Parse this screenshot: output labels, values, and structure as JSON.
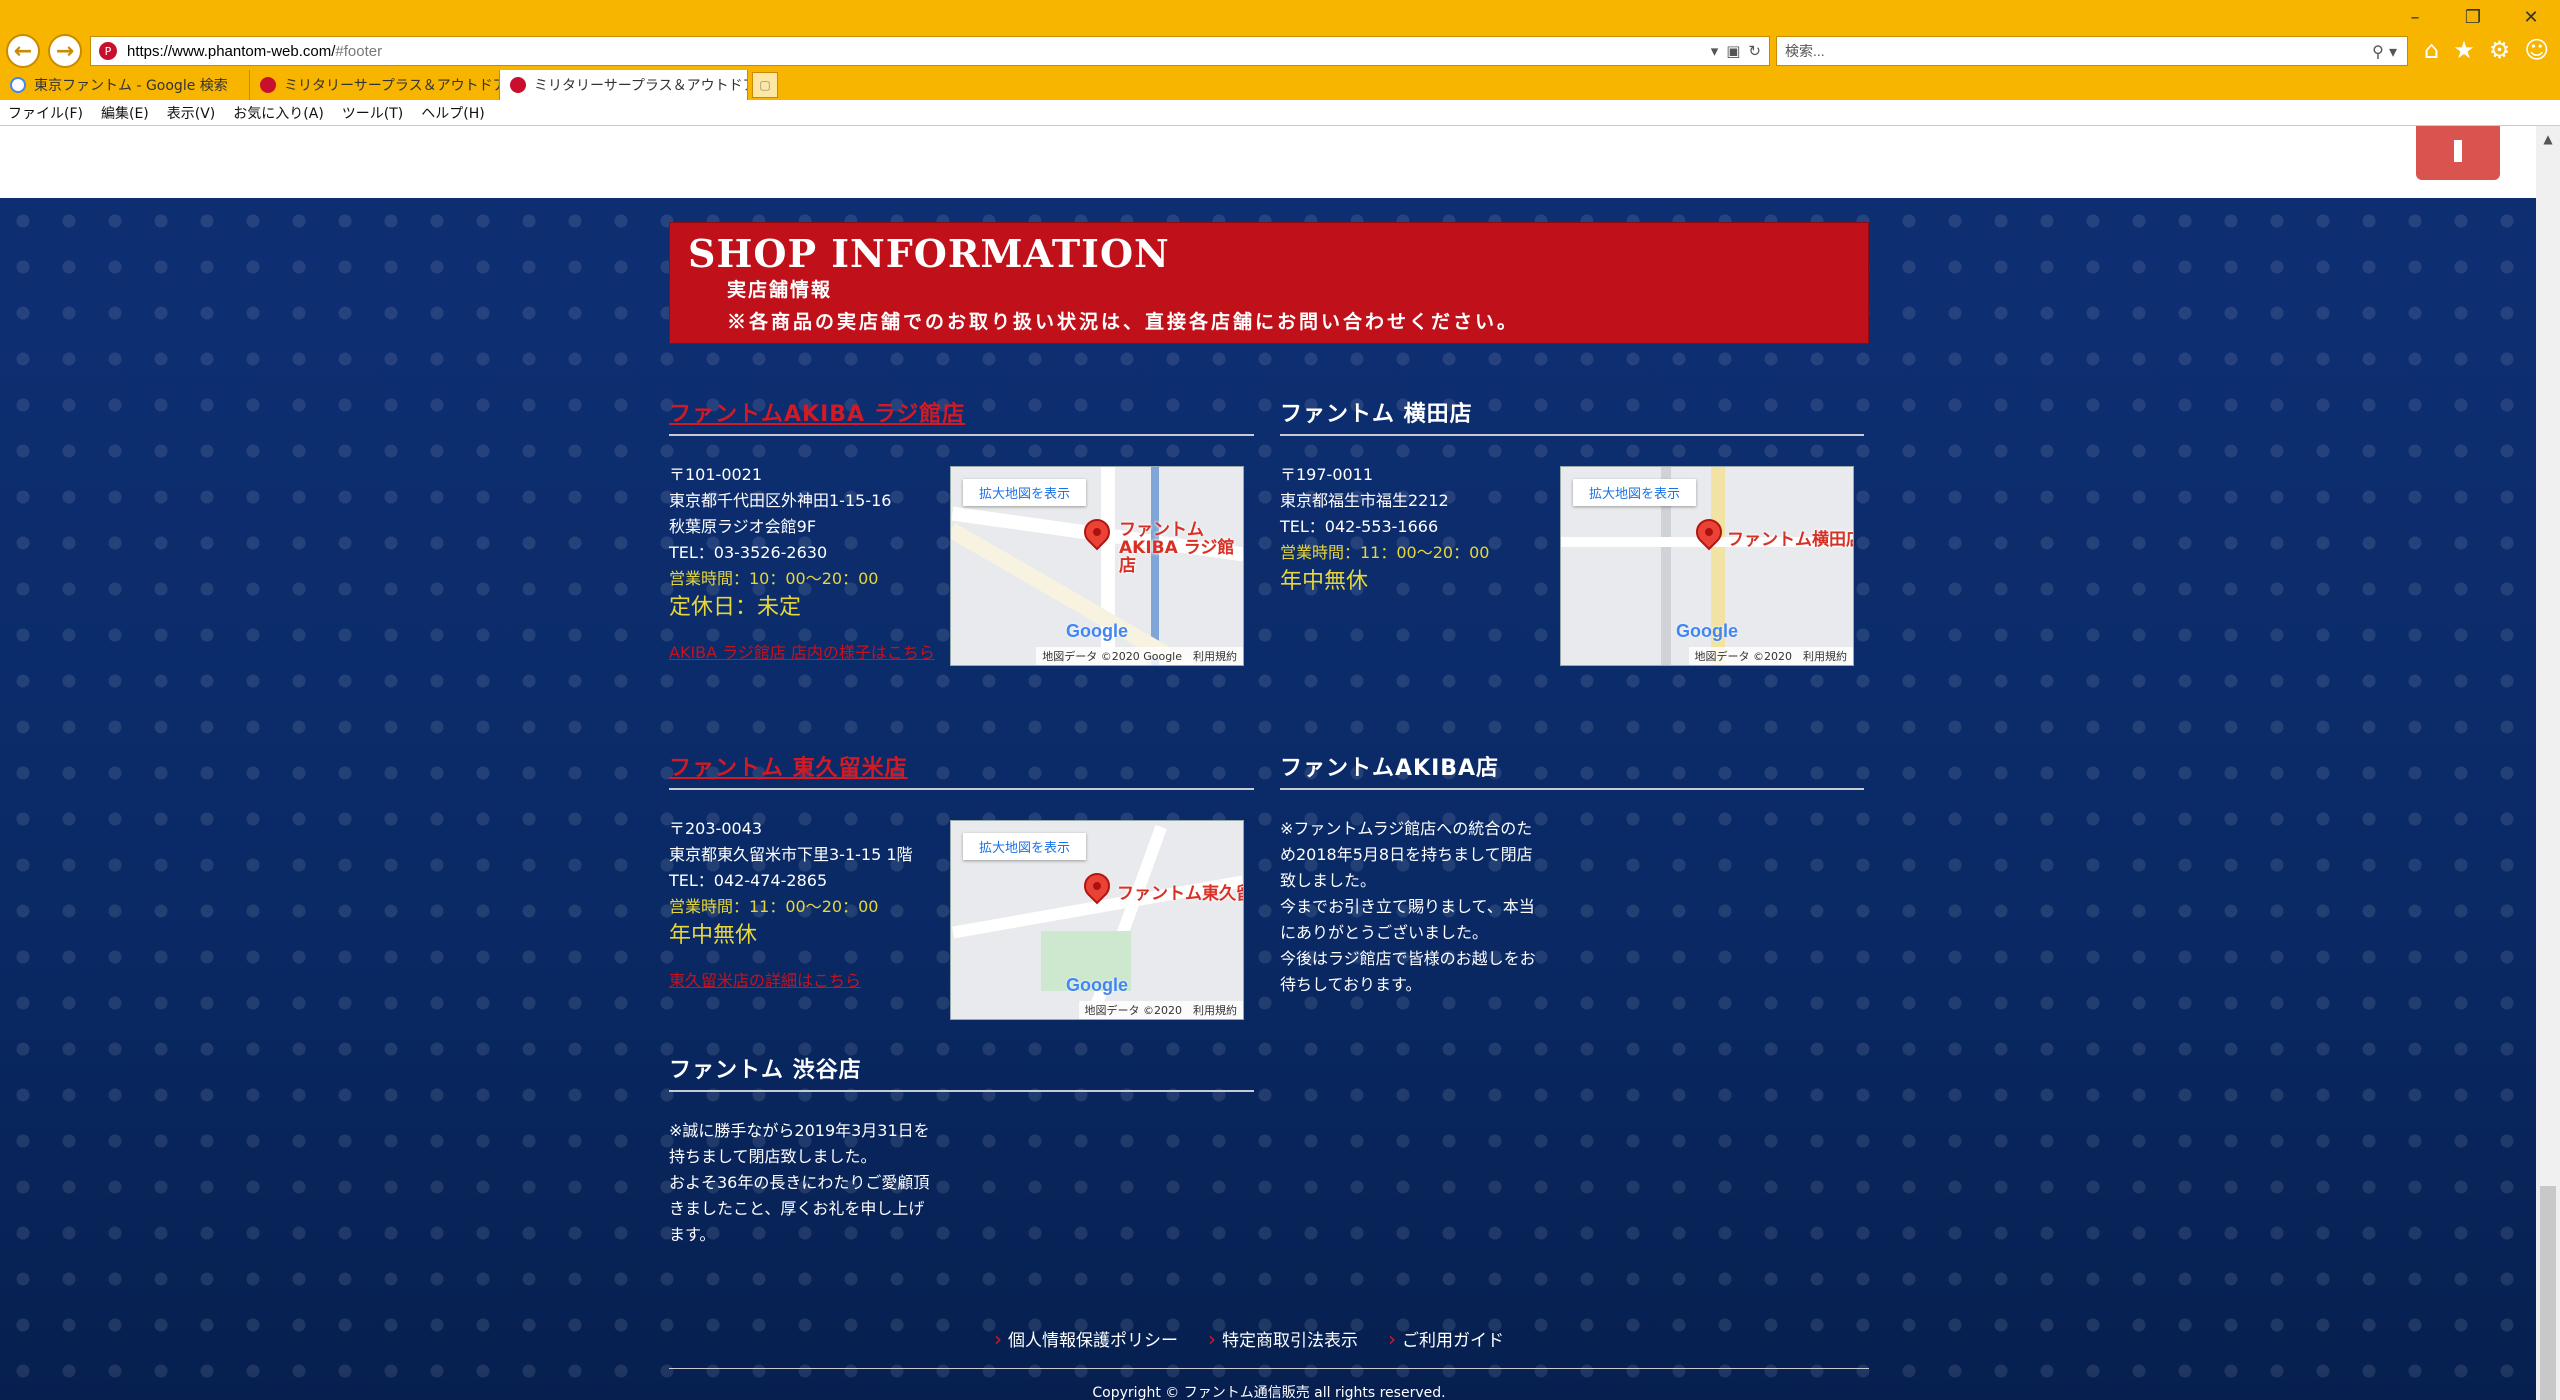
{
  "browser": {
    "url_host": "https://www.phantom-web.com/",
    "url_path": "#footer",
    "search_placeholder": "検索...",
    "tabs": [
      {
        "label": "東京ファントム - Google 検索"
      },
      {
        "label": "ミリタリーサープラス＆アウトドアギア..."
      },
      {
        "label": "ミリタリーサープラス＆アウトドア..."
      }
    ],
    "menu": [
      "ファイル(F)",
      "編集(E)",
      "表示(V)",
      "お気に入り(A)",
      "ツール(T)",
      "ヘルプ(H)"
    ]
  },
  "banner": {
    "title": "SHOP INFORMATION",
    "subtitle": "実店舗情報",
    "note": "※各商品の実店舗でのお取り扱い状況は、直接各店舗にお問い合わせください。"
  },
  "shops": {
    "akiba_radio": {
      "name": "ファントムAKIBA ラジ館店",
      "postal": "〒101-0021",
      "addr1": "東京都千代田区外神田1-15-16",
      "addr2": "秋葉原ラジオ会館9F",
      "tel": "TEL：03-3526-2630",
      "hours": "営業時間：10：00〜20：00",
      "closed": "定休日：未定",
      "link": "AKIBA ラジ館店 店内の様子はこちら",
      "map": {
        "btn": "拡大地図を表示",
        "label": "ファントム AKIBA ラジ館店",
        "credit": "地図データ ©2020 Google　利用規約"
      }
    },
    "yokota": {
      "name": "ファントム 横田店",
      "postal": "〒197-0011",
      "addr1": "東京都福生市福生2212",
      "tel": "TEL：042-553-1666",
      "hours": "営業時間：11：00〜20：00",
      "closed": "年中無休",
      "map": {
        "btn": "拡大地図を表示",
        "label": "ファントム横田店",
        "credit": "地図データ ©2020　利用規約"
      }
    },
    "higashikurume": {
      "name": "ファントム 東久留米店",
      "postal": "〒203-0043",
      "addr1": "東京都東久留米市下里3-1-15 1階",
      "tel": "TEL：042-474-2865",
      "hours": "営業時間：11：00〜20：00",
      "closed": "年中無休",
      "link": "東久留米店の詳細はこちら",
      "map": {
        "btn": "拡大地図を表示",
        "label": "ファントム東久留",
        "credit": "地図データ ©2020　利用規約"
      }
    },
    "akiba": {
      "name": "ファントムAKIBA店",
      "note": [
        "※ファントムラジ館店への統合のた",
        "め2018年5月8日を持ちまして閉店",
        "致しました。",
        "今までお引き立て賜りまして、本当",
        "にありがとうございました。",
        "今後はラジ館店で皆様のお越しをお",
        "待ちしております。"
      ]
    },
    "shibuya": {
      "name": "ファントム 渋谷店",
      "note": [
        "※誠に勝手ながら2019年3月31日を",
        "持ちまして閉店致しました。",
        "およそ36年の長きにわたりご愛顧頂",
        "きましたこと、厚くお礼を申し上げ",
        "ます。"
      ]
    }
  },
  "footer": {
    "links": [
      "個人情報保護ポリシー",
      "特定商取引法表示",
      "ご利用ガイド"
    ],
    "copyright": "Copyright © ファントム通信販売 all rights reserved."
  }
}
